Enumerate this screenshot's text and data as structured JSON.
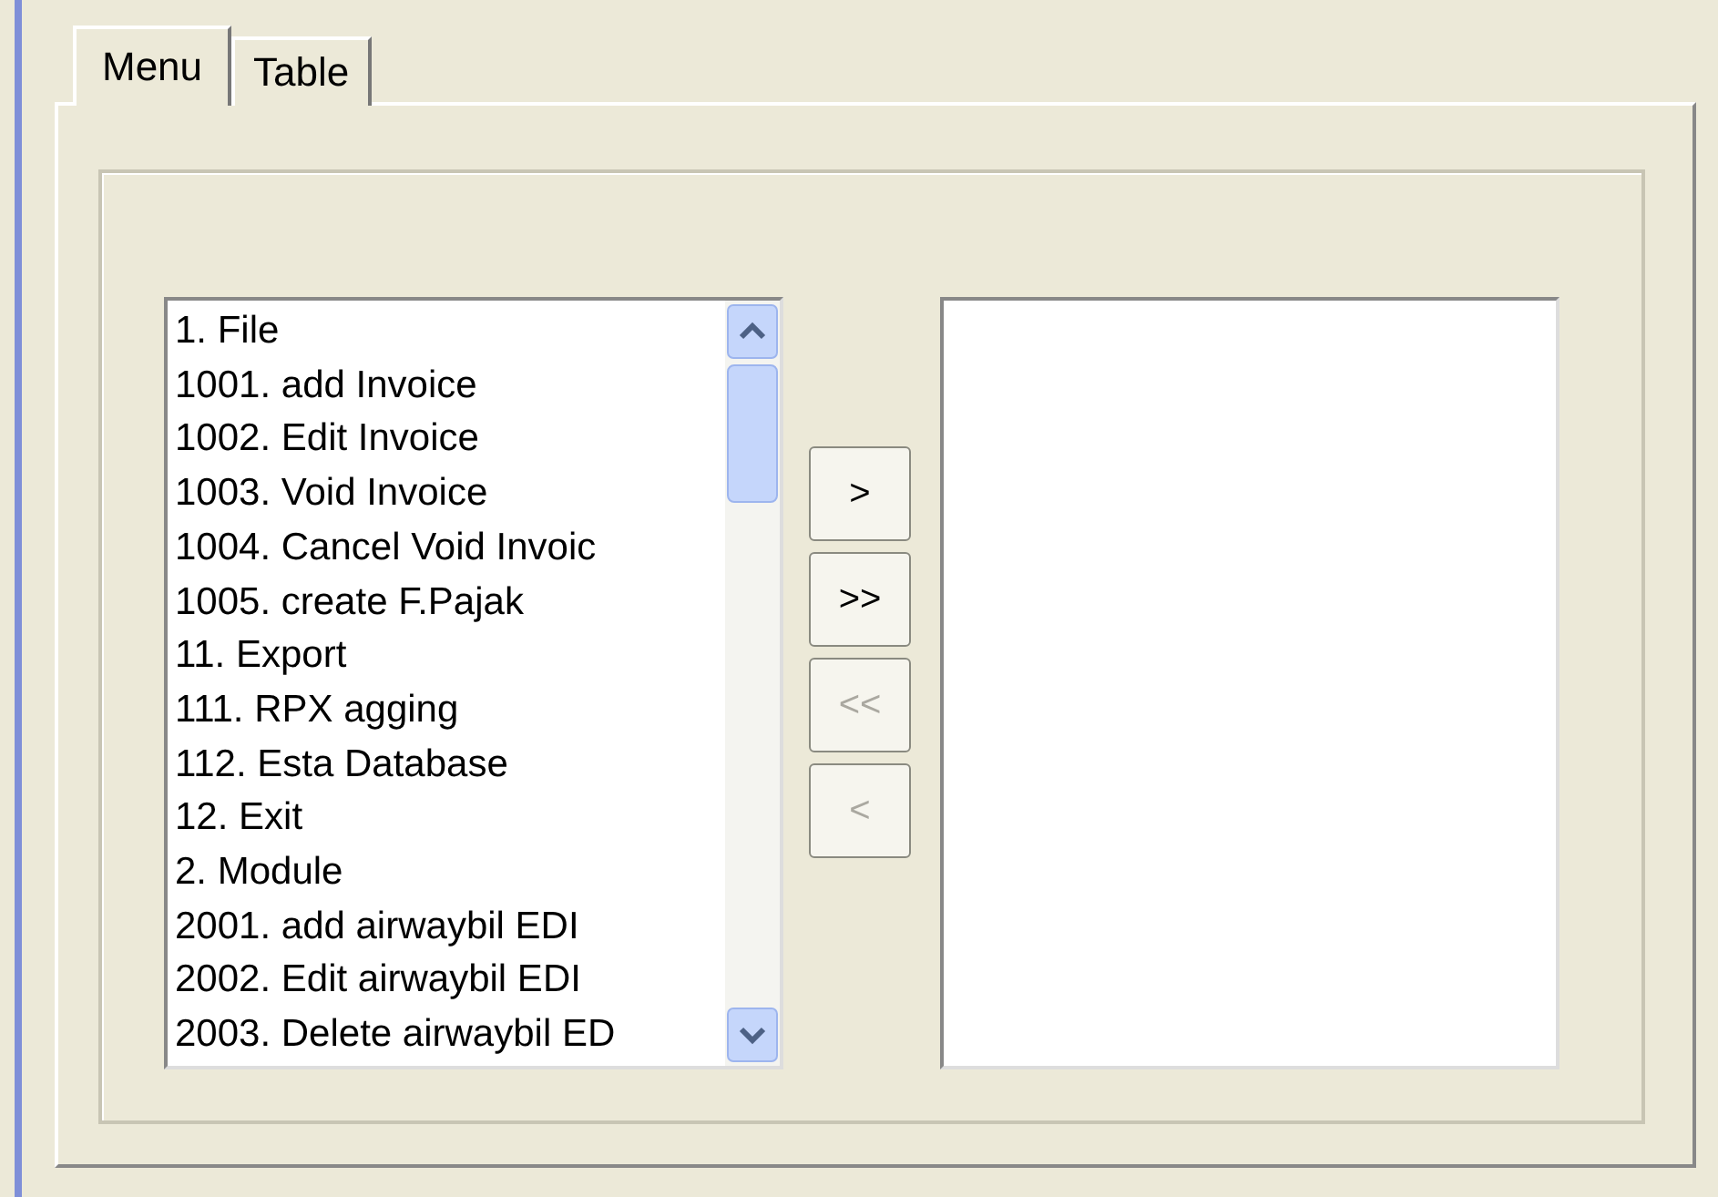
{
  "tabs": [
    {
      "label": "Menu",
      "selected": true
    },
    {
      "label": "Table",
      "selected": false
    }
  ],
  "menu_list": {
    "items": [
      "1. File",
      "1001. add Invoice",
      "1002. Edit Invoice",
      "1003. Void Invoice",
      "1004. Cancel Void Invoic",
      "1005. create F.Pajak",
      "11. Export",
      "111. RPX agging",
      "112. Esta Database",
      "12. Exit",
      "2. Module",
      "2001. add airwaybil EDI",
      "2002. Edit airwaybil EDI",
      "2003. Delete airwaybil ED"
    ]
  },
  "transfer_buttons": [
    {
      "label": ">",
      "disabled": false
    },
    {
      "label": ">>",
      "disabled": false
    },
    {
      "label": "<<",
      "disabled": true
    },
    {
      "label": "<",
      "disabled": true
    }
  ]
}
